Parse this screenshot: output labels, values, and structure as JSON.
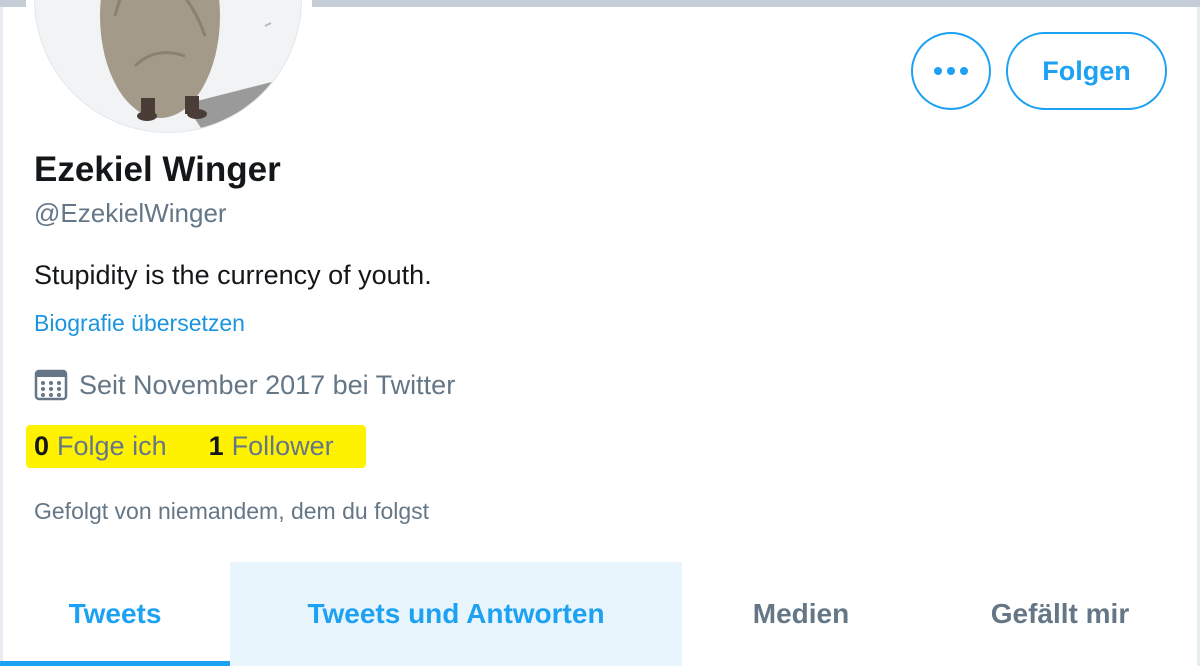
{
  "profile": {
    "name": "Ezekiel Winger",
    "handle": "@EzekielWinger",
    "bio": "Stupidity is the currency of youth.",
    "translate_link": "Biografie übersetzen",
    "joined": "Seit November 2017 bei Twitter",
    "following_count": "0",
    "following_label": "Folge ich",
    "followers_count": "1",
    "followers_label": "Follower",
    "followed_by": "Gefolgt von niemandem, dem du folgst"
  },
  "actions": {
    "follow_label": "Folgen",
    "more_icon": "more-horizontal-icon"
  },
  "tabs": [
    {
      "label": "Tweets"
    },
    {
      "label": "Tweets und Antworten"
    },
    {
      "label": "Medien"
    },
    {
      "label": "Gefällt mir"
    }
  ],
  "colors": {
    "accent": "#1da1f2",
    "link": "#1b95e0",
    "secondary_text": "#657786",
    "highlight": "#fff200",
    "tab_hover": "#e8f5fd"
  }
}
